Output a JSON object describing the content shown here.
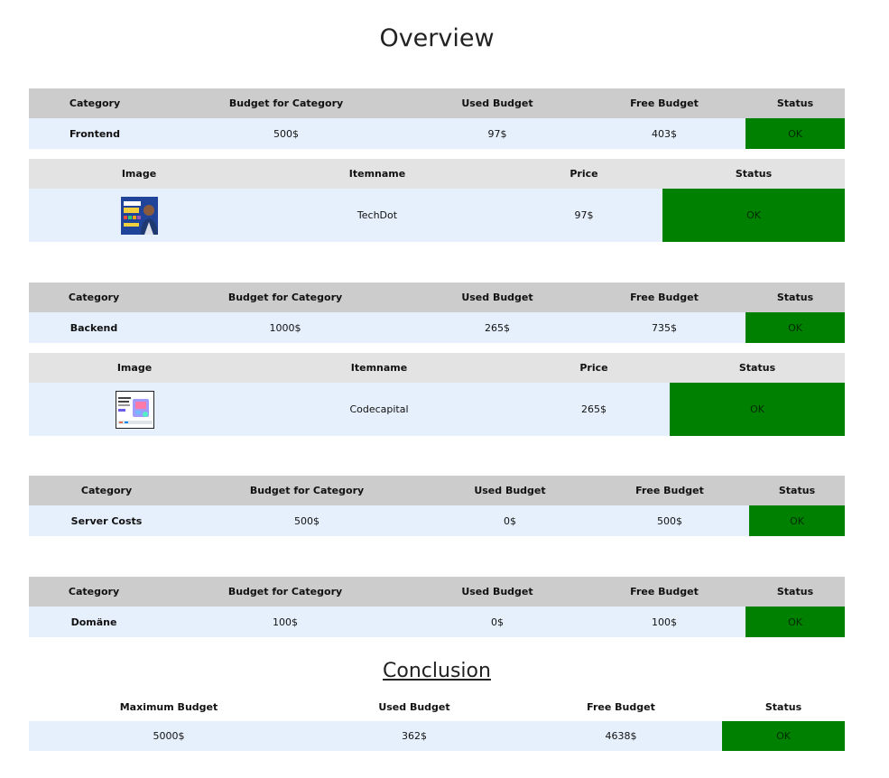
{
  "title": "Overview",
  "category_headers": {
    "category": "Category",
    "budget": "Budget for Category",
    "used": "Used Budget",
    "free": "Free Budget",
    "status": "Status"
  },
  "item_headers": {
    "image": "Image",
    "itemname": "Itemname",
    "price": "Price",
    "status": "Status"
  },
  "categories": [
    {
      "name": "Frontend",
      "budget": "500$",
      "used": "97$",
      "free": "403$",
      "status": "OK",
      "items": [
        {
          "image_icon": "website-development-thumbnail-icon",
          "name": "TechDot",
          "price": "97$",
          "status": "OK"
        }
      ]
    },
    {
      "name": "Backend",
      "budget": "1000$",
      "used": "265$",
      "free": "735$",
      "status": "OK",
      "items": [
        {
          "image_icon": "codecapital-thumbnail-icon",
          "name": "Codecapital",
          "price": "265$",
          "status": "OK"
        }
      ]
    },
    {
      "name": "Server Costs",
      "budget": "500$",
      "used": "0$",
      "free": "500$",
      "status": "OK",
      "items": []
    },
    {
      "name": "Domäne",
      "budget": "100$",
      "used": "0$",
      "free": "100$",
      "status": "OK",
      "items": []
    }
  ],
  "conclusion": {
    "title": "Conclusion",
    "headers": {
      "max": "Maximum Budget",
      "used": "Used Budget",
      "free": "Free Budget",
      "status": "Status"
    },
    "max": "5000$",
    "used": "362$",
    "free": "4638$",
    "status": "OK"
  },
  "colors": {
    "header_bg": "#cccccc",
    "item_header_bg": "#e3e3e3",
    "row_bg": "#e6f0fc",
    "status_ok": "#008000"
  }
}
